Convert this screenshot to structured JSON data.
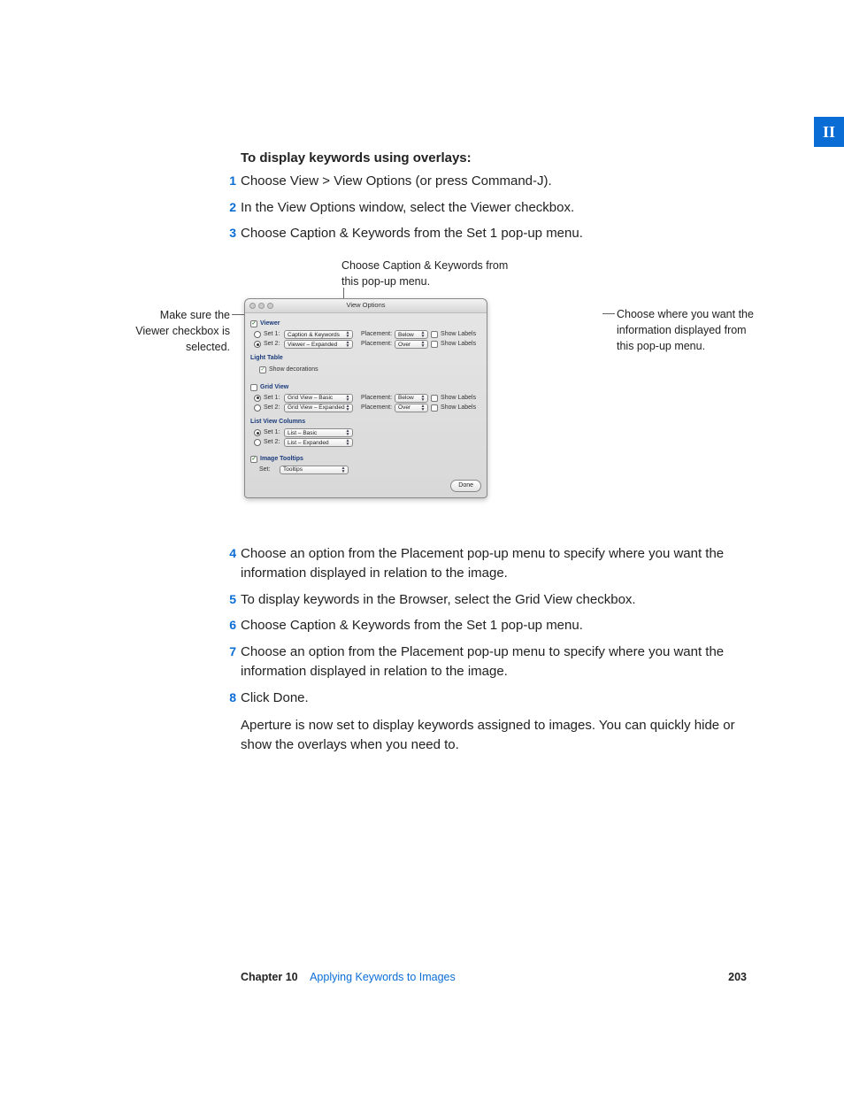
{
  "part_tab": "II",
  "section_heading": "To display keywords using overlays:",
  "steps_a": [
    {
      "n": "1",
      "t": "Choose View > View Options (or press Command-J)."
    },
    {
      "n": "2",
      "t": "In the View Options window, select the Viewer checkbox."
    },
    {
      "n": "3",
      "t": "Choose Caption & Keywords from the Set 1 pop-up menu."
    }
  ],
  "callouts": {
    "top": "Choose Caption & Keywords from this pop-up menu.",
    "left": "Make sure the Viewer checkbox is selected.",
    "right": "Choose where you want the information displayed from this pop-up menu."
  },
  "panel": {
    "title": "View Options",
    "viewer": {
      "label": "Viewer",
      "rows": [
        {
          "radio": false,
          "set": "Set 1:",
          "popup": "Caption & Keywords",
          "plabel": "Placement:",
          "pval": "Below",
          "show": "Show Labels"
        },
        {
          "radio": true,
          "set": "Set 2:",
          "popup": "Viewer – Expanded",
          "plabel": "Placement:",
          "pval": "Over",
          "show": "Show Labels"
        }
      ]
    },
    "light_table": {
      "label": "Light Table",
      "dec": "Show decorations"
    },
    "grid": {
      "label": "Grid View",
      "rows": [
        {
          "radio": true,
          "set": "Set 1:",
          "popup": "Grid View – Basic",
          "plabel": "Placement:",
          "pval": "Below",
          "show": "Show Labels"
        },
        {
          "radio": false,
          "set": "Set 2:",
          "popup": "Grid View – Expanded",
          "plabel": "Placement:",
          "pval": "Over",
          "show": "Show Labels"
        }
      ]
    },
    "list": {
      "label": "List View Columns",
      "rows": [
        {
          "radio": true,
          "set": "Set 1:",
          "popup": "List – Basic"
        },
        {
          "radio": false,
          "set": "Set 2:",
          "popup": "List – Expanded"
        }
      ]
    },
    "tooltips": {
      "label": "Image Tooltips",
      "set": "Set:",
      "popup": "Tooltips"
    },
    "done": "Done"
  },
  "steps_b": [
    {
      "n": "4",
      "t": "Choose an option from the Placement pop-up menu to specify where you want the information displayed in relation to the image."
    },
    {
      "n": "5",
      "t": "To display keywords in the Browser, select the Grid View checkbox."
    },
    {
      "n": "6",
      "t": "Choose Caption & Keywords from the Set 1 pop-up menu."
    },
    {
      "n": "7",
      "t": "Choose an option from the Placement pop-up menu to specify where you want the information displayed in relation to the image."
    },
    {
      "n": "8",
      "t": "Click Done."
    }
  ],
  "closing": "Aperture is now set to display keywords assigned to images. You can quickly hide or show the overlays when you need to.",
  "footer": {
    "chapter": "Chapter 10",
    "title": "Applying Keywords to Images",
    "page": "203"
  }
}
